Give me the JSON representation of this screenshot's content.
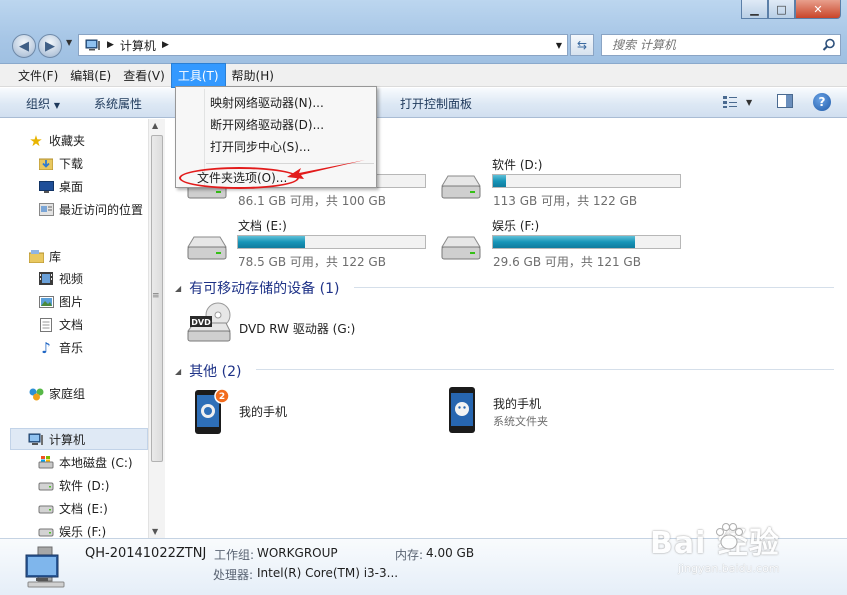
{
  "address": {
    "path_label": "计算机",
    "search_placeholder": "搜索 计算机"
  },
  "menubar": [
    {
      "label": "文件(F)"
    },
    {
      "label": "编辑(E)"
    },
    {
      "label": "查看(V)"
    },
    {
      "label": "工具(T)",
      "active": true
    },
    {
      "label": "帮助(H)"
    }
  ],
  "tools_menu": {
    "items": [
      {
        "label": "映射网络驱动器(N)..."
      },
      {
        "label": "断开网络驱动器(D)..."
      },
      {
        "label": "打开同步中心(S)..."
      },
      {
        "label": "文件夹选项(O)..."
      }
    ],
    "highlighted_item": "文件夹选项(O)..."
  },
  "command_bar": {
    "organize_label": "组织",
    "properties_label": "系统属性",
    "control_panel_label": "打开控制面板"
  },
  "sidebar": {
    "favorites": {
      "label": "收藏夹",
      "items": [
        {
          "label": "下载"
        },
        {
          "label": "桌面"
        },
        {
          "label": "最近访问的位置"
        }
      ]
    },
    "libraries": {
      "label": "库",
      "items": [
        {
          "label": "视频"
        },
        {
          "label": "图片"
        },
        {
          "label": "文档"
        },
        {
          "label": "音乐"
        }
      ]
    },
    "homegroup": {
      "label": "家庭组"
    },
    "computer": {
      "label": "计算机",
      "items": [
        {
          "label": "本地磁盘 (C:)"
        },
        {
          "label": "软件 (D:)"
        },
        {
          "label": "文档 (E:)"
        },
        {
          "label": "娱乐 (F:)"
        }
      ]
    }
  },
  "drives": [
    {
      "name": "",
      "free_text": "86.1 GB 可用，共 100 GB",
      "used_fraction": 0.14
    },
    {
      "name": "软件 (D:)",
      "free_text": "113 GB 可用，共 122 GB",
      "used_fraction": 0.07
    },
    {
      "name": "文档 (E:)",
      "free_text": "78.5 GB 可用，共 122 GB",
      "used_fraction": 0.36
    },
    {
      "name": "娱乐 (F:)",
      "free_text": "29.6 GB 可用，共 121 GB",
      "used_fraction": 0.76
    }
  ],
  "removable": {
    "title": "有可移动存储的设备 (1)",
    "items": [
      {
        "name": "DVD RW 驱动器 (G:)",
        "icon_text": "DVD"
      }
    ]
  },
  "other": {
    "title": "其他 (2)",
    "items": [
      {
        "name": "我的手机",
        "badge": "2"
      },
      {
        "name": "我的手机",
        "subtitle": "系统文件夹"
      }
    ]
  },
  "details": {
    "computer_name": "QH-20141022ZTNJ",
    "workgroup_label": "工作组:",
    "workgroup_value": "WORKGROUP",
    "memory_label": "内存:",
    "memory_value": "4.00 GB",
    "processor_label": "处理器:",
    "processor_value": "Intel(R) Core(TM) i3-3..."
  },
  "watermark": {
    "text": "Bai  经验",
    "url": "jingyan.baidu.com"
  },
  "colors": {
    "accent": "#3399ff",
    "drive_fill": "#1795b8",
    "group_title": "#1e3287",
    "annotation_red": "#e21b1b"
  }
}
